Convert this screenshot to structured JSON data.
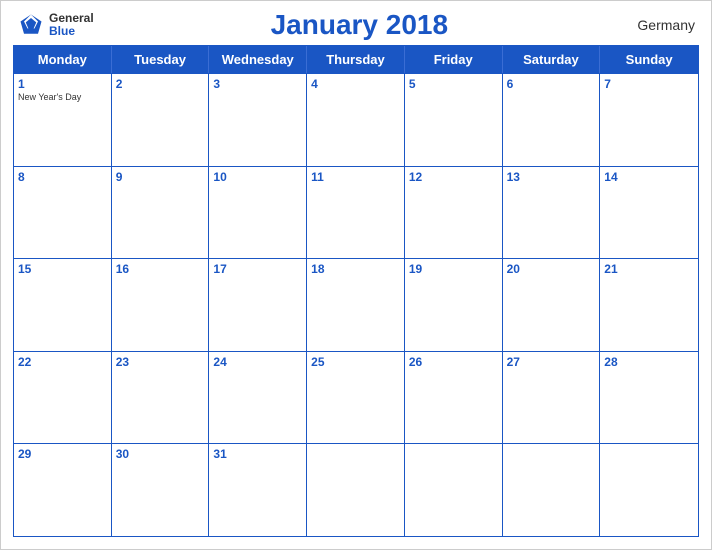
{
  "header": {
    "logo_general": "General",
    "logo_blue": "Blue",
    "title": "January 2018",
    "country": "Germany"
  },
  "days": {
    "headers": [
      "Monday",
      "Tuesday",
      "Wednesday",
      "Thursday",
      "Friday",
      "Saturday",
      "Sunday"
    ]
  },
  "weeks": [
    [
      {
        "num": "1",
        "holiday": "New Year's Day"
      },
      {
        "num": "2",
        "holiday": ""
      },
      {
        "num": "3",
        "holiday": ""
      },
      {
        "num": "4",
        "holiday": ""
      },
      {
        "num": "5",
        "holiday": ""
      },
      {
        "num": "6",
        "holiday": ""
      },
      {
        "num": "7",
        "holiday": ""
      }
    ],
    [
      {
        "num": "8",
        "holiday": ""
      },
      {
        "num": "9",
        "holiday": ""
      },
      {
        "num": "10",
        "holiday": ""
      },
      {
        "num": "11",
        "holiday": ""
      },
      {
        "num": "12",
        "holiday": ""
      },
      {
        "num": "13",
        "holiday": ""
      },
      {
        "num": "14",
        "holiday": ""
      }
    ],
    [
      {
        "num": "15",
        "holiday": ""
      },
      {
        "num": "16",
        "holiday": ""
      },
      {
        "num": "17",
        "holiday": ""
      },
      {
        "num": "18",
        "holiday": ""
      },
      {
        "num": "19",
        "holiday": ""
      },
      {
        "num": "20",
        "holiday": ""
      },
      {
        "num": "21",
        "holiday": ""
      }
    ],
    [
      {
        "num": "22",
        "holiday": ""
      },
      {
        "num": "23",
        "holiday": ""
      },
      {
        "num": "24",
        "holiday": ""
      },
      {
        "num": "25",
        "holiday": ""
      },
      {
        "num": "26",
        "holiday": ""
      },
      {
        "num": "27",
        "holiday": ""
      },
      {
        "num": "28",
        "holiday": ""
      }
    ],
    [
      {
        "num": "29",
        "holiday": ""
      },
      {
        "num": "30",
        "holiday": ""
      },
      {
        "num": "31",
        "holiday": ""
      },
      {
        "num": "",
        "holiday": ""
      },
      {
        "num": "",
        "holiday": ""
      },
      {
        "num": "",
        "holiday": ""
      },
      {
        "num": "",
        "holiday": ""
      }
    ]
  ]
}
